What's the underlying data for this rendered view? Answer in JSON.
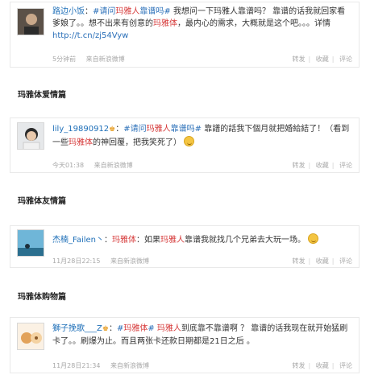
{
  "posts": [
    {
      "user": "路边小饭",
      "vip_mark": "",
      "text_a": "：",
      "topic_a": "#请问",
      "topic_red": "玛雅人",
      "topic_b": "靠谱吗#",
      "text_b": " 我想问一下玛雅人靠谱吗？ 靠谱的话我就回家看爹娘了。。想不出来有创意的",
      "mark": "玛雅体",
      "text_c": "，最内心的需求，大概就是这个吧。。。详情",
      "link": "http://t.cn/zj54Vyw",
      "time": "5分钟前",
      "source": "来自新浪微博",
      "actions": [
        "转发",
        "收藏",
        "评论"
      ]
    },
    {
      "user": "lily_19890912",
      "vip_mark": "♚",
      "text_a": "：",
      "topic_a": "#请问",
      "topic_red": "玛雅人",
      "topic_b": "靠谱吗#",
      "text_b": " 靠譜的話我下個月就把婚給結了！（看到一些",
      "mark": "玛雅体",
      "text_c": "的神回覆，把我笑死了）",
      "time": "今天01:38",
      "source": "来自新浪微博",
      "actions": [
        "转发",
        "收藏",
        "评论"
      ]
    },
    {
      "user": "杰楠_Failen丶",
      "vip_mark": "",
      "text_a": "：",
      "mark": "玛雅体",
      "text_b": "：如果",
      "mark2": "玛雅人",
      "text_c": "靠谱我就找几个兄弟去大玩一场。",
      "time": "11月28日22:15",
      "source": "来自新浪微博",
      "actions": [
        "转发",
        "收藏",
        "评论"
      ]
    },
    {
      "user": "獅子挽歌___Z",
      "vip_mark": "♚",
      "text_a": "：",
      "topic_a": "#",
      "topic_mark": "玛雅体",
      "topic_b": "#",
      "text_b": " ",
      "mark": "玛雅人",
      "text_c": "到底靠不靠谱啊 ？ 靠谱的话我现在就开始猛刷卡了。。刷爆为止。而且两张卡还款日期都是21日之后 。",
      "time": "11月28日21:34",
      "source": "来自新浪微博",
      "actions": [
        "转发",
        "收藏",
        "评论"
      ]
    }
  ],
  "sections": [
    "玛雅体爱情篇",
    "玛雅体友情篇",
    "玛雅体购物篇"
  ]
}
